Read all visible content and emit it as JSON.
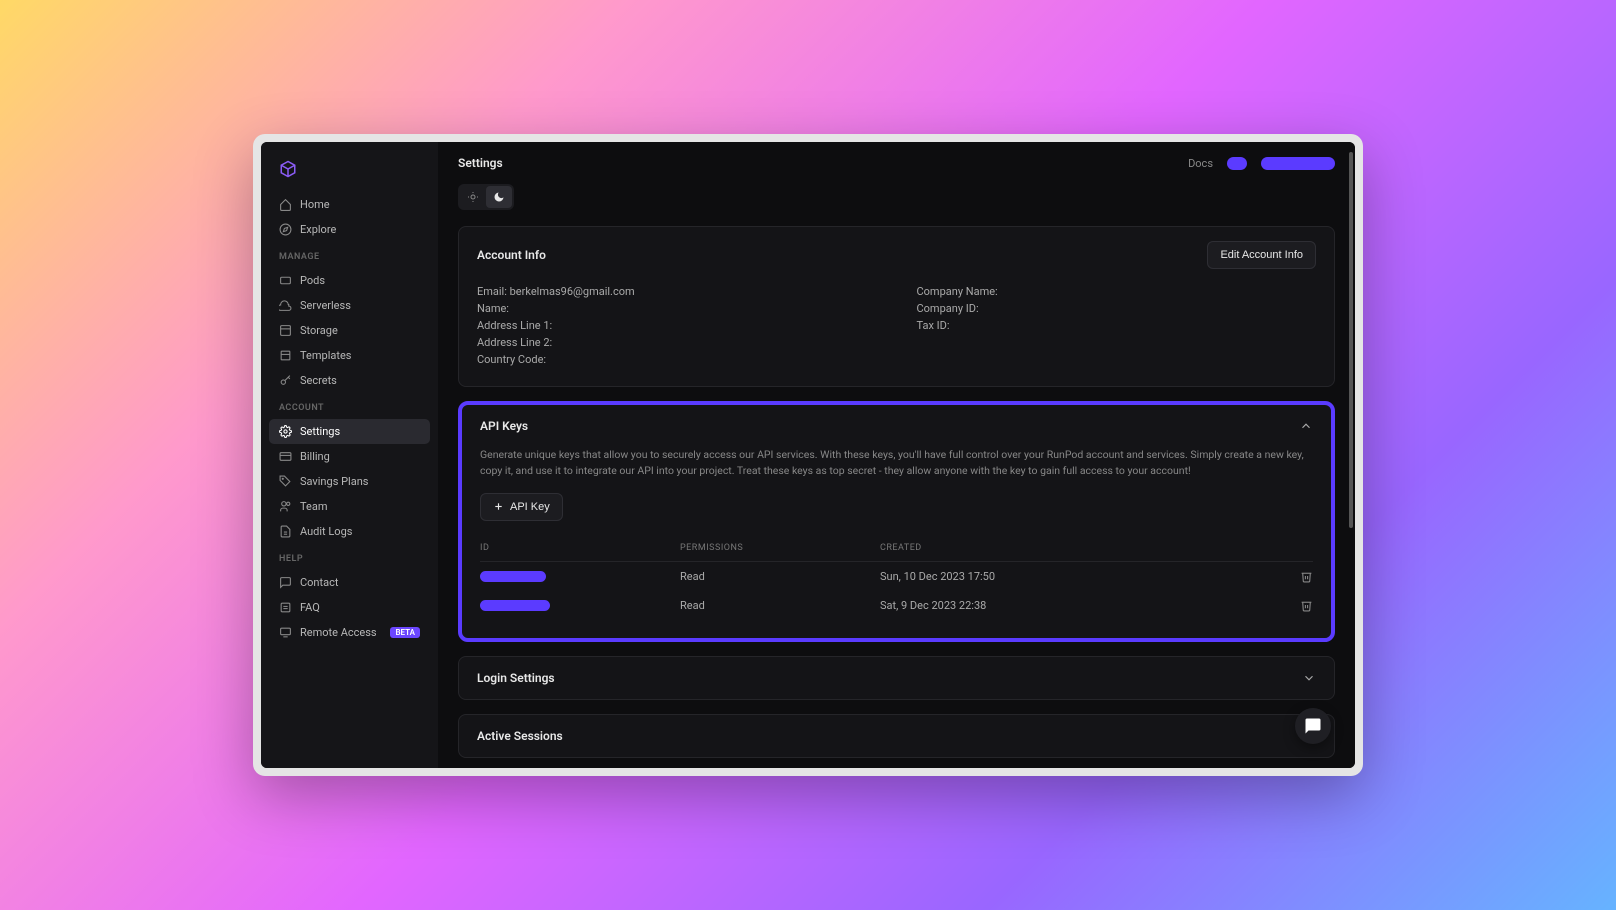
{
  "page": {
    "title": "Settings"
  },
  "topbar": {
    "docs": "Docs"
  },
  "sidebar": {
    "items_main": [
      {
        "label": "Home",
        "icon": "home"
      },
      {
        "label": "Explore",
        "icon": "compass"
      }
    ],
    "section_manage": "MANAGE",
    "items_manage": [
      {
        "label": "Pods",
        "icon": "pods"
      },
      {
        "label": "Serverless",
        "icon": "cloud"
      },
      {
        "label": "Storage",
        "icon": "storage"
      },
      {
        "label": "Templates",
        "icon": "templates"
      },
      {
        "label": "Secrets",
        "icon": "key"
      }
    ],
    "section_account": "ACCOUNT",
    "items_account": [
      {
        "label": "Settings",
        "icon": "gear",
        "active": true
      },
      {
        "label": "Billing",
        "icon": "billing"
      },
      {
        "label": "Savings Plans",
        "icon": "tag"
      },
      {
        "label": "Team",
        "icon": "team"
      },
      {
        "label": "Audit Logs",
        "icon": "audit"
      }
    ],
    "section_help": "HELP",
    "items_help": [
      {
        "label": "Contact",
        "icon": "contact"
      },
      {
        "label": "FAQ",
        "icon": "faq"
      },
      {
        "label": "Remote Access",
        "icon": "remote",
        "badge": "BETA"
      }
    ]
  },
  "account_info": {
    "title": "Account Info",
    "edit_btn": "Edit Account Info",
    "rows_left": [
      "Email: berkelmas96@gmail.com",
      "Name:",
      "Address Line 1:",
      "Address Line 2:",
      "Country Code:"
    ],
    "rows_right": [
      "Company Name:",
      "Company ID:",
      "Tax ID:"
    ]
  },
  "api_keys": {
    "title": "API Keys",
    "desc": "Generate unique keys that allow you to securely access our API services. With these keys, you'll have full control over your RunPod account and services. Simply create a new key, copy it, and use it to integrate our API into your project. Treat these keys as top secret - they allow anyone with the key to gain full access to your account!",
    "add_btn": "API Key",
    "headers": {
      "id": "ID",
      "perms": "PERMISSIONS",
      "created": "CREATED"
    },
    "rows": [
      {
        "perm": "Read",
        "created": "Sun, 10 Dec 2023 17:50"
      },
      {
        "perm": "Read",
        "created": "Sat, 9 Dec 2023 22:38"
      }
    ]
  },
  "login": {
    "title": "Login Settings"
  },
  "sessions": {
    "title": "Active Sessions"
  }
}
